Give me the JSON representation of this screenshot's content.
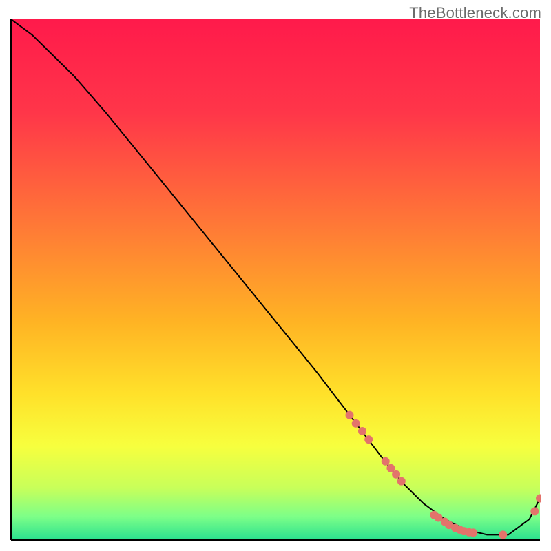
{
  "watermark": "TheBottleneck.com",
  "chart_data": {
    "type": "line",
    "title": "",
    "xlabel": "",
    "ylabel": "",
    "xlim": [
      0,
      100
    ],
    "ylim": [
      0,
      100
    ],
    "grid": false,
    "legend": false,
    "gradient_stops": [
      {
        "offset": 0.0,
        "color": "#ff1a4b"
      },
      {
        "offset": 0.18,
        "color": "#ff3649"
      },
      {
        "offset": 0.4,
        "color": "#ff7a36"
      },
      {
        "offset": 0.58,
        "color": "#ffb324"
      },
      {
        "offset": 0.72,
        "color": "#ffe12a"
      },
      {
        "offset": 0.82,
        "color": "#f7ff3e"
      },
      {
        "offset": 0.9,
        "color": "#c8ff5a"
      },
      {
        "offset": 0.955,
        "color": "#7dff88"
      },
      {
        "offset": 1.0,
        "color": "#29e08f"
      }
    ],
    "series": [
      {
        "name": "bottleneck-curve",
        "x": [
          0,
          4,
          8,
          12,
          18,
          26,
          34,
          42,
          50,
          58,
          64,
          70,
          74,
          78,
          82,
          86,
          90,
          94,
          98,
          100
        ],
        "y": [
          100,
          97,
          93,
          89,
          82,
          72,
          62,
          52,
          42,
          32,
          24,
          16,
          11,
          7,
          4,
          2,
          1,
          1,
          4,
          8
        ],
        "color": "#000000",
        "marker": false
      }
    ],
    "scatter": {
      "name": "highlight-points",
      "color": "#e3736b",
      "radius": 6,
      "points": [
        {
          "x": 64.0,
          "y": 24.0
        },
        {
          "x": 65.2,
          "y": 22.4
        },
        {
          "x": 66.4,
          "y": 20.9
        },
        {
          "x": 67.6,
          "y": 19.3
        },
        {
          "x": 70.8,
          "y": 15.1
        },
        {
          "x": 71.8,
          "y": 13.8
        },
        {
          "x": 72.8,
          "y": 12.6
        },
        {
          "x": 73.8,
          "y": 11.3
        },
        {
          "x": 80.0,
          "y": 4.8
        },
        {
          "x": 80.8,
          "y": 4.3
        },
        {
          "x": 82.0,
          "y": 3.5
        },
        {
          "x": 82.8,
          "y": 2.9
        },
        {
          "x": 84.0,
          "y": 2.3
        },
        {
          "x": 84.8,
          "y": 2.0
        },
        {
          "x": 85.6,
          "y": 1.7
        },
        {
          "x": 86.6,
          "y": 1.5
        },
        {
          "x": 87.4,
          "y": 1.4
        },
        {
          "x": 93.0,
          "y": 1.0
        },
        {
          "x": 99.0,
          "y": 5.5
        },
        {
          "x": 100.0,
          "y": 8.0
        }
      ]
    }
  }
}
